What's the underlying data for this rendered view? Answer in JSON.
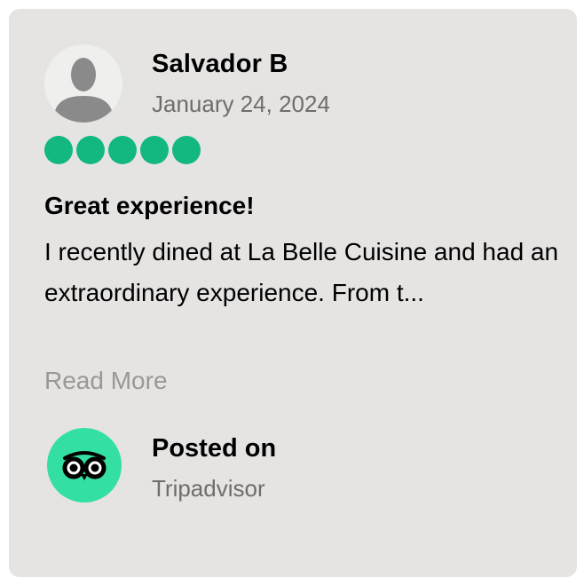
{
  "reviewer": {
    "name": "Salvador B",
    "date": "January 24, 2024",
    "avatar_icon": "default-user-avatar-icon"
  },
  "rating": {
    "value": 5,
    "max": 5,
    "color": "#13b881"
  },
  "review": {
    "title": "Great experience!",
    "text": "I recently dined at La Belle Cuisine and had an extraordinary experience. From t...",
    "read_more_label": "Read More"
  },
  "source": {
    "posted_label": "Posted on",
    "name": "Tripadvisor",
    "logo_icon": "tripadvisor-owl-icon",
    "logo_color": "#34e0a1"
  },
  "colors": {
    "card_background": "#e6e4e3",
    "muted_text": "#6f6d6b",
    "link_text": "#9a9896"
  }
}
